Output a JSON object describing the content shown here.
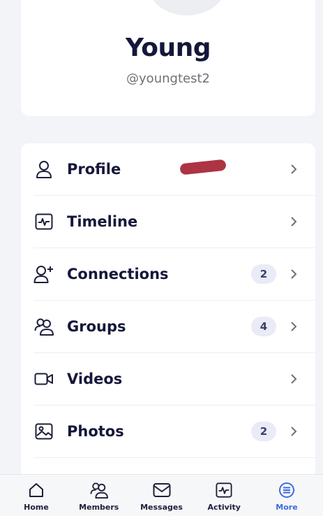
{
  "profile": {
    "display_name": "Young",
    "username": "@youngtest2"
  },
  "menu": {
    "items": [
      {
        "label": "Profile",
        "icon": "user-icon",
        "badge": ""
      },
      {
        "label": "Timeline",
        "icon": "activity-icon",
        "badge": ""
      },
      {
        "label": "Connections",
        "icon": "user-plus-icon",
        "badge": "2"
      },
      {
        "label": "Groups",
        "icon": "group-icon",
        "badge": "4"
      },
      {
        "label": "Videos",
        "icon": "video-icon",
        "badge": ""
      },
      {
        "label": "Photos",
        "icon": "photo-icon",
        "badge": "2"
      }
    ]
  },
  "tabbar": {
    "tabs": [
      {
        "label": "Home",
        "icon": "home-icon"
      },
      {
        "label": "Members",
        "icon": "members-icon"
      },
      {
        "label": "Messages",
        "icon": "envelope-icon"
      },
      {
        "label": "Activity",
        "icon": "activity-icon"
      },
      {
        "label": "More",
        "icon": "more-icon"
      }
    ],
    "active": "More"
  },
  "colors": {
    "accent": "#3f6ae0",
    "text": "#15173a",
    "badge_bg": "#e9ebf7",
    "redaction": "#a41e2e"
  }
}
